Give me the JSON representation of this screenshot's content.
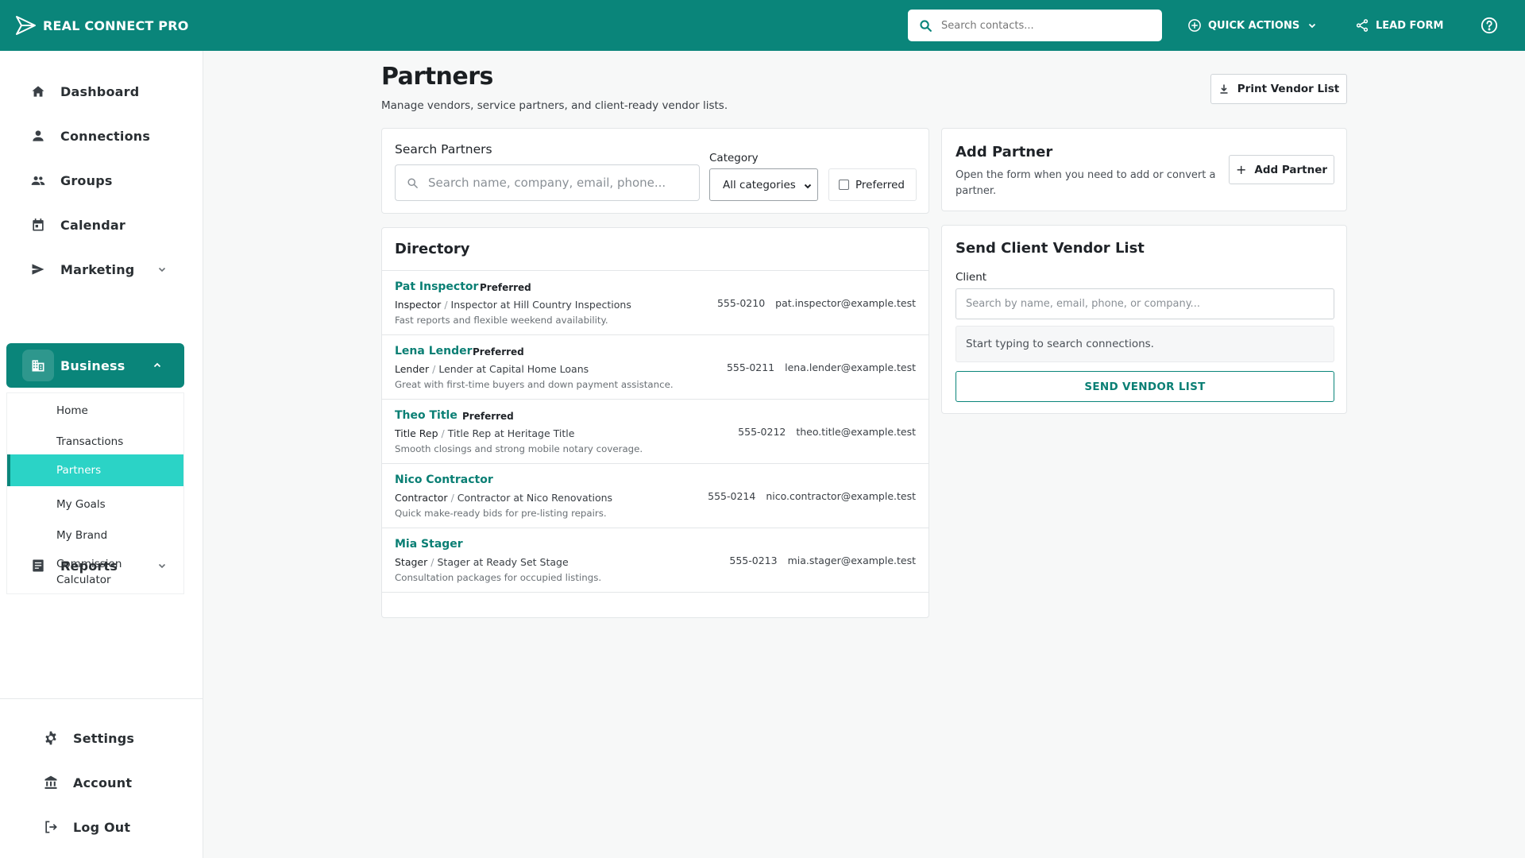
{
  "app": {
    "name": "REAL CONNECT PRO"
  },
  "colors": {
    "primary": "#0a857a",
    "active_sub": "#2bd3c6",
    "link": "#0a7f74"
  },
  "topbar": {
    "search_placeholder": "Search contacts...",
    "quick_actions": "QUICK ACTIONS",
    "lead_form": "LEAD FORM",
    "icons": [
      "logo-icon",
      "search-icon",
      "plus-circle-icon",
      "chevron-down-icon",
      "share-icon",
      "help-icon"
    ]
  },
  "sidebar": {
    "items": [
      {
        "label": "Dashboard",
        "icon": "home-icon"
      },
      {
        "label": "Connections",
        "icon": "person-icon"
      },
      {
        "label": "Groups",
        "icon": "people-icon"
      },
      {
        "label": "Calendar",
        "icon": "calendar-icon"
      },
      {
        "label": "Marketing",
        "icon": "send-icon",
        "expandable": true
      },
      {
        "label": "Business",
        "icon": "business-icon",
        "expandable": true,
        "expanded": true,
        "active": true
      },
      {
        "label": "Reports",
        "icon": "report-icon",
        "expandable": true
      }
    ],
    "sub_items": [
      "Home",
      "Transactions",
      "Partners",
      "My Goals",
      "My Brand",
      "Commission Calculator"
    ],
    "active_sub": "Partners",
    "bottom": [
      {
        "label": "Settings",
        "icon": "gear-icon"
      },
      {
        "label": "Account",
        "icon": "bank-icon"
      },
      {
        "label": "Log Out",
        "icon": "logout-icon"
      }
    ]
  },
  "page": {
    "title": "Partners",
    "subtitle": "Manage vendors, service partners, and client-ready vendor lists.",
    "print_button": "Print Vendor List"
  },
  "search_card": {
    "label": "Search Partners",
    "placeholder": "Search name, company, email, phone...",
    "category_label": "Category",
    "category_value": "All categories",
    "preferred_label": "Preferred"
  },
  "directory": {
    "title": "Directory",
    "rows": [
      {
        "name": "Pat Inspector",
        "badge": "Preferred",
        "type": "Inspector",
        "desc": "Inspector at Hill Country Inspections",
        "note": "Fast reports and flexible weekend availability.",
        "phone": "555-0210",
        "email": "pat.inspector@example.test"
      },
      {
        "name": "Lena Lender",
        "badge": "Preferred",
        "type": "Lender",
        "desc": "Lender at Capital Home Loans",
        "note": "Great with first-time buyers and down payment assistance.",
        "phone": "555-0211",
        "email": "lena.lender@example.test"
      },
      {
        "name": "Theo Title",
        "badge": "Preferred",
        "type": "Title Rep",
        "desc": "Title Rep at Heritage Title",
        "note": "Smooth closings and strong mobile notary coverage.",
        "phone": "555-0212",
        "email": "theo.title@example.test"
      },
      {
        "name": "Nico Contractor",
        "badge": "",
        "type": "Contractor",
        "desc": "Contractor at Nico Renovations",
        "note": "Quick make-ready bids for pre-listing repairs.",
        "phone": "555-0214",
        "email": "nico.contractor@example.test"
      },
      {
        "name": "Mia Stager",
        "badge": "",
        "type": "Stager",
        "desc": "Stager at Ready Set Stage",
        "note": "Consultation packages for occupied listings.",
        "phone": "555-0213",
        "email": "mia.stager@example.test"
      }
    ]
  },
  "add_partner": {
    "title": "Add Partner",
    "description": "Open the form when you need to add or convert a partner.",
    "button": "Add Partner"
  },
  "send_list": {
    "title": "Send Client Vendor List",
    "client_label": "Client",
    "client_placeholder": "Search by name, email, phone, or company...",
    "hint": "Start typing to search connections.",
    "button": "SEND VENDOR LIST"
  }
}
